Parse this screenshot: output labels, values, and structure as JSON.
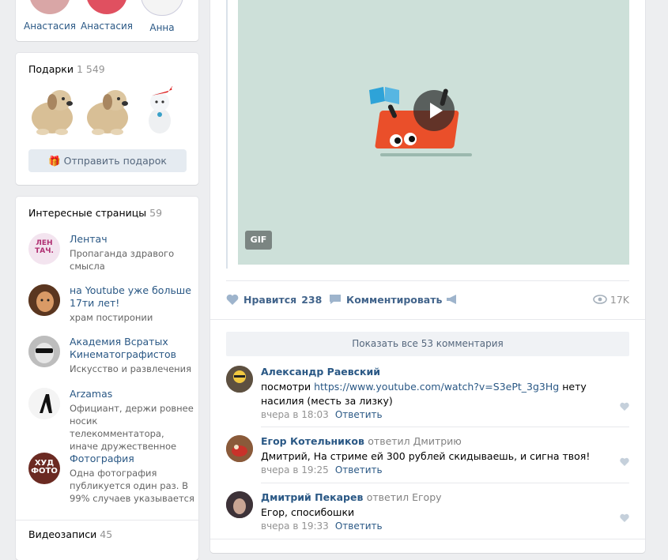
{
  "friends": [
    {
      "name": "Анастасия"
    },
    {
      "name": "Анастасия"
    },
    {
      "name": "Анна"
    }
  ],
  "gifts": {
    "title": "Подарки",
    "count": "1 549",
    "send_label": "Отправить подарок",
    "icons": [
      "dog-gift-icon",
      "dog-gift-icon",
      "santa-dog-gift-icon"
    ]
  },
  "pages": {
    "title": "Интересные страницы",
    "count": "59",
    "items": [
      {
        "name": "Лентач",
        "desc": "Пропаганда здравого смысла",
        "avatar_text": "ЛЕН ТАЧ."
      },
      {
        "name": "на Youtube уже больше 17ти лет!",
        "desc": "храм постиронии",
        "avatar_text": ""
      },
      {
        "name": "Академия Всратых Кинематографистов",
        "desc": "Искусство и развлечения",
        "avatar_text": ""
      },
      {
        "name": "Arzamas",
        "desc": "Официант, держи ровнее носик телекомментатора, иначе дружественное",
        "avatar_text": ""
      },
      {
        "name": "Фотография",
        "desc": "Одна фотография публикуется один раз. В 99% случаев указывается",
        "avatar_text": "ХУД ФОТО"
      }
    ]
  },
  "videos": {
    "title": "Видеозаписи",
    "count": "45"
  },
  "post": {
    "gif_label": "GIF",
    "likes_label": "Нравится",
    "likes_count": "238",
    "comment_label": "Комментировать",
    "views": "17K",
    "show_all": "Показать все 53 комментария"
  },
  "comments": [
    {
      "author": "Александр Раевский",
      "reply_to": "",
      "text_before": "посмотри ",
      "link": "https://www.youtube.com/watch?v=S3ePt_3g3Hg",
      "text_after": " нету насилия (месть за лизку)",
      "time": "вчера в 18:03",
      "reply": "Ответить"
    },
    {
      "author": "Егор Котельников",
      "reply_to": "ответил Дмитрию",
      "text_before": "Дмитрий, На стриме ей 300 рублей скидываешь, и сигна твоя!",
      "link": "",
      "text_after": "",
      "time": "вчера в 19:25",
      "reply": "Ответить"
    },
    {
      "author": "Дмитрий Пекарев",
      "reply_to": "ответил Егору",
      "text_before": "Егор, спосибошки",
      "link": "",
      "text_after": "",
      "time": "вчера в 19:33",
      "reply": "Ответить"
    }
  ],
  "colors": {
    "link": "#2a5885",
    "background": "#edeef0",
    "gif_bg": "#cde0d9"
  }
}
